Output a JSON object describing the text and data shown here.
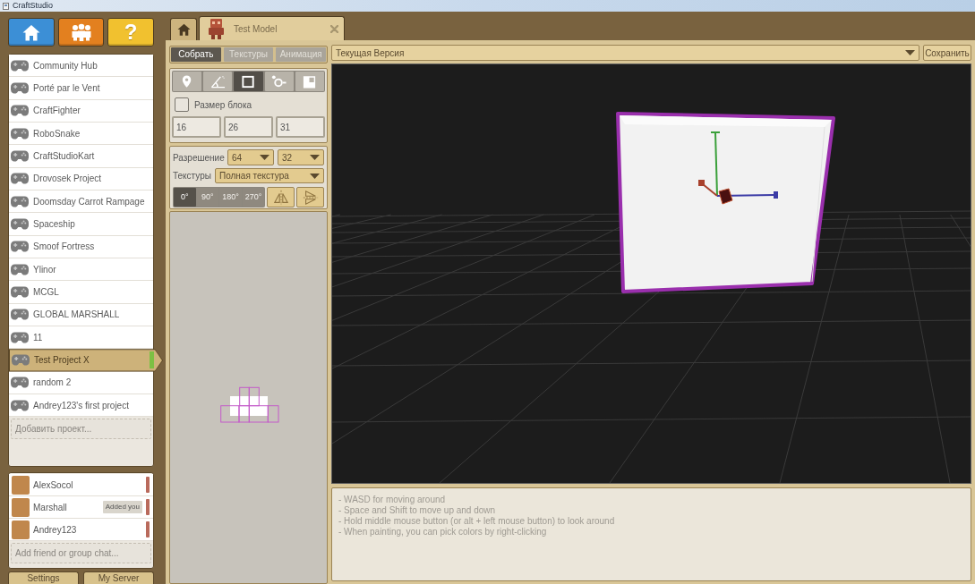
{
  "window": {
    "title": "CraftStudio"
  },
  "nav_buttons": [
    {
      "kind": "home"
    },
    {
      "kind": "community"
    },
    {
      "kind": "help",
      "label": "?"
    }
  ],
  "projects": {
    "items": [
      {
        "name": "Community Hub",
        "selected": false
      },
      {
        "name": "Porté par le Vent",
        "selected": false
      },
      {
        "name": "CraftFighter",
        "selected": false
      },
      {
        "name": "RoboSnake",
        "selected": false
      },
      {
        "name": "CraftStudioKart",
        "selected": false
      },
      {
        "name": "Drovosek Project",
        "selected": false
      },
      {
        "name": "Doomsday Carrot Rampage",
        "selected": false
      },
      {
        "name": "Spaceship",
        "selected": false
      },
      {
        "name": "Smoof Fortress",
        "selected": false
      },
      {
        "name": "Ylinor",
        "selected": false
      },
      {
        "name": "MCGL",
        "selected": false
      },
      {
        "name": "GLOBAL MARSHALL",
        "selected": false
      },
      {
        "name": "11",
        "selected": false
      },
      {
        "name": "Test Project X",
        "selected": true
      },
      {
        "name": "random 2",
        "selected": false
      },
      {
        "name": "Andrey123's first project",
        "selected": false
      }
    ],
    "add_placeholder": "Добавить проект..."
  },
  "friends": {
    "items": [
      {
        "name": "AlexSocol"
      },
      {
        "name": "Marshall",
        "badge": "Added you"
      },
      {
        "name": "Andrey123"
      }
    ],
    "add_placeholder": "Add friend or group chat..."
  },
  "footer_buttons": [
    "Settings",
    "My Server"
  ],
  "document_tabs": [
    {
      "kind": "home",
      "selected": false
    },
    {
      "kind": "model",
      "label": "Test Model",
      "selected": true
    }
  ],
  "editor": {
    "mode_tabs": [
      {
        "label": "Собрать",
        "selected": true
      },
      {
        "label": "Текстуры",
        "selected": false
      },
      {
        "label": "Анимация",
        "selected": false
      }
    ],
    "tools": [
      {
        "kind": "pin",
        "selected": false
      },
      {
        "kind": "angle",
        "selected": false
      },
      {
        "kind": "box",
        "selected": true
      },
      {
        "kind": "joint",
        "selected": false
      },
      {
        "kind": "resize",
        "selected": false
      }
    ],
    "block_size": {
      "label": "Размер блока",
      "checked": false
    },
    "size_fields": [
      "16",
      "26",
      "31"
    ],
    "resolution": {
      "label": "Разрешение",
      "values": [
        "64",
        "32"
      ]
    },
    "textures": {
      "label": "Текстуры",
      "value": "Полная текстура"
    },
    "rotations": [
      {
        "label": "0°",
        "selected": true
      },
      {
        "label": "90°",
        "selected": false
      },
      {
        "label": "180°",
        "selected": false
      },
      {
        "label": "270°",
        "selected": false
      }
    ],
    "mirror_buttons": [
      {
        "kind": "vertical_axis"
      },
      {
        "kind": "horizontal_axis"
      }
    ]
  },
  "version_select": {
    "value": "Текущая Версия"
  },
  "save_button": {
    "label": "Сохранить"
  },
  "help_lines": [
    "- WASD for moving around",
    "- Space and Shift to move up and down",
    "- Hold middle mouse button (or alt + left mouse button) to look around",
    "- When painting, you can pick colors by right-clicking"
  ]
}
